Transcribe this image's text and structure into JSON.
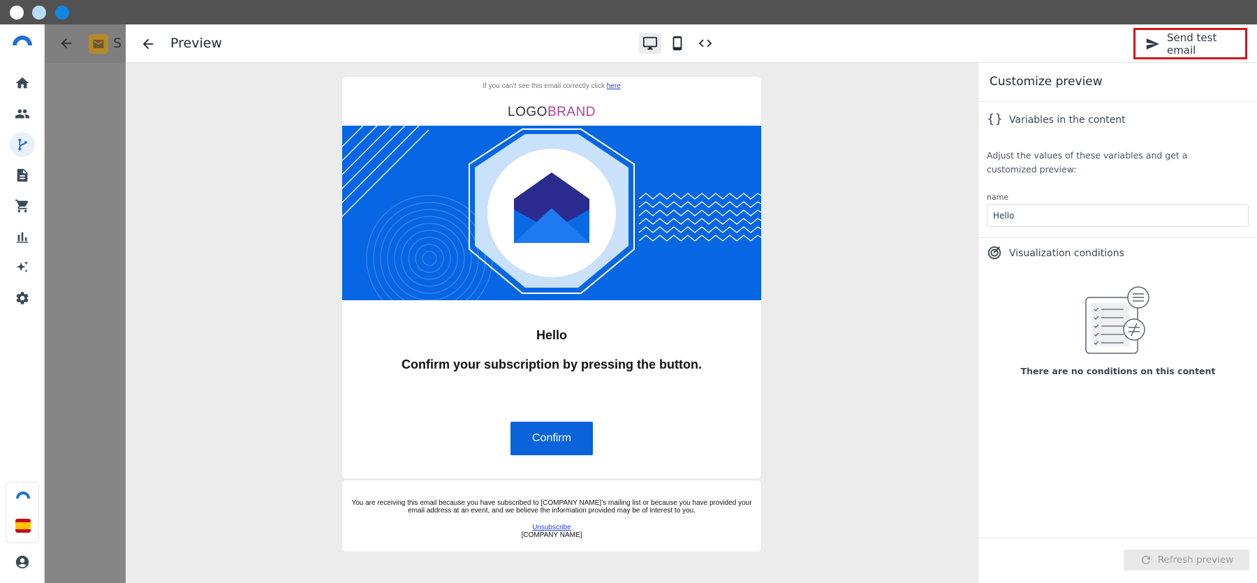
{
  "window": {
    "controls": [
      "close",
      "minimize",
      "maximize"
    ]
  },
  "sidebar": {
    "items": [
      {
        "name": "home",
        "icon": "home-icon"
      },
      {
        "name": "contacts",
        "icon": "people-icon"
      },
      {
        "name": "automations",
        "icon": "flow-icon",
        "active": true
      },
      {
        "name": "content",
        "icon": "document-icon"
      },
      {
        "name": "ecommerce",
        "icon": "cart-icon"
      },
      {
        "name": "reports",
        "icon": "bar-chart-icon"
      },
      {
        "name": "ai",
        "icon": "sparkle-icon"
      },
      {
        "name": "settings",
        "icon": "gear-icon"
      }
    ]
  },
  "background": {
    "partial_title": "S"
  },
  "header": {
    "title": "Preview",
    "send_test_label": "Send test email"
  },
  "email": {
    "preheader_text": "If you can't see this email correctly click",
    "preheader_link": "here",
    "logo_part1": "LOGO",
    "logo_part2": "BRAND",
    "greeting": "Hello",
    "message": "Confirm your subscription by pressing the button.",
    "button_label": "Confirm",
    "footer_text": "You are receiving this email because you have subscribed to [COMPANY NAME]'s mailing list or because you have provided your email address at an event, and we believe the information provided may be of interest to you.",
    "unsubscribe_label": "Unsubscribe",
    "company_name": "[COMPANY NAME]"
  },
  "panel": {
    "title": "Customize preview",
    "variables_title": "Variables in the content",
    "variables_icon_text": "{}",
    "variables_desc": "Adjust the values of these variables and get a customized preview:",
    "field_label": "name",
    "field_value": "Hello",
    "conditions_title": "Visualization conditions",
    "no_conditions": "There are no conditions on this content",
    "refresh_label": "Refresh preview"
  },
  "colors": {
    "accent": "#0766e3",
    "highlight_border": "#d6131a",
    "logo_brand": "#b5409c"
  }
}
